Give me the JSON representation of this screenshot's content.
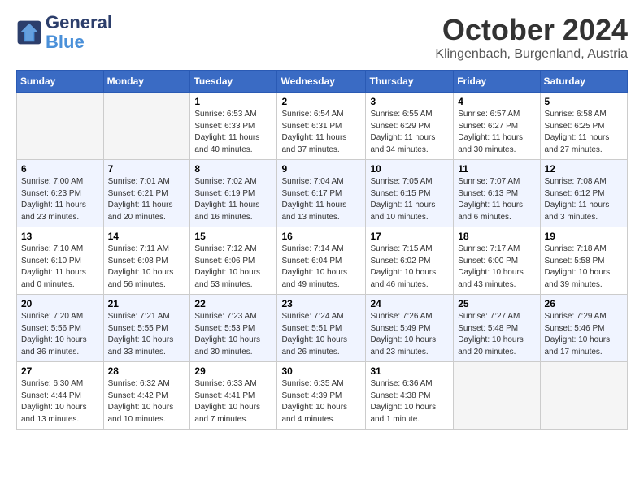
{
  "header": {
    "logo_line1": "General",
    "logo_line2": "Blue",
    "month": "October 2024",
    "location": "Klingenbach, Burgenland, Austria"
  },
  "weekdays": [
    "Sunday",
    "Monday",
    "Tuesday",
    "Wednesday",
    "Thursday",
    "Friday",
    "Saturday"
  ],
  "weeks": [
    [
      {
        "num": "",
        "info": ""
      },
      {
        "num": "",
        "info": ""
      },
      {
        "num": "1",
        "info": "Sunrise: 6:53 AM\nSunset: 6:33 PM\nDaylight: 11 hours and 40 minutes."
      },
      {
        "num": "2",
        "info": "Sunrise: 6:54 AM\nSunset: 6:31 PM\nDaylight: 11 hours and 37 minutes."
      },
      {
        "num": "3",
        "info": "Sunrise: 6:55 AM\nSunset: 6:29 PM\nDaylight: 11 hours and 34 minutes."
      },
      {
        "num": "4",
        "info": "Sunrise: 6:57 AM\nSunset: 6:27 PM\nDaylight: 11 hours and 30 minutes."
      },
      {
        "num": "5",
        "info": "Sunrise: 6:58 AM\nSunset: 6:25 PM\nDaylight: 11 hours and 27 minutes."
      }
    ],
    [
      {
        "num": "6",
        "info": "Sunrise: 7:00 AM\nSunset: 6:23 PM\nDaylight: 11 hours and 23 minutes."
      },
      {
        "num": "7",
        "info": "Sunrise: 7:01 AM\nSunset: 6:21 PM\nDaylight: 11 hours and 20 minutes."
      },
      {
        "num": "8",
        "info": "Sunrise: 7:02 AM\nSunset: 6:19 PM\nDaylight: 11 hours and 16 minutes."
      },
      {
        "num": "9",
        "info": "Sunrise: 7:04 AM\nSunset: 6:17 PM\nDaylight: 11 hours and 13 minutes."
      },
      {
        "num": "10",
        "info": "Sunrise: 7:05 AM\nSunset: 6:15 PM\nDaylight: 11 hours and 10 minutes."
      },
      {
        "num": "11",
        "info": "Sunrise: 7:07 AM\nSunset: 6:13 PM\nDaylight: 11 hours and 6 minutes."
      },
      {
        "num": "12",
        "info": "Sunrise: 7:08 AM\nSunset: 6:12 PM\nDaylight: 11 hours and 3 minutes."
      }
    ],
    [
      {
        "num": "13",
        "info": "Sunrise: 7:10 AM\nSunset: 6:10 PM\nDaylight: 11 hours and 0 minutes."
      },
      {
        "num": "14",
        "info": "Sunrise: 7:11 AM\nSunset: 6:08 PM\nDaylight: 10 hours and 56 minutes."
      },
      {
        "num": "15",
        "info": "Sunrise: 7:12 AM\nSunset: 6:06 PM\nDaylight: 10 hours and 53 minutes."
      },
      {
        "num": "16",
        "info": "Sunrise: 7:14 AM\nSunset: 6:04 PM\nDaylight: 10 hours and 49 minutes."
      },
      {
        "num": "17",
        "info": "Sunrise: 7:15 AM\nSunset: 6:02 PM\nDaylight: 10 hours and 46 minutes."
      },
      {
        "num": "18",
        "info": "Sunrise: 7:17 AM\nSunset: 6:00 PM\nDaylight: 10 hours and 43 minutes."
      },
      {
        "num": "19",
        "info": "Sunrise: 7:18 AM\nSunset: 5:58 PM\nDaylight: 10 hours and 39 minutes."
      }
    ],
    [
      {
        "num": "20",
        "info": "Sunrise: 7:20 AM\nSunset: 5:56 PM\nDaylight: 10 hours and 36 minutes."
      },
      {
        "num": "21",
        "info": "Sunrise: 7:21 AM\nSunset: 5:55 PM\nDaylight: 10 hours and 33 minutes."
      },
      {
        "num": "22",
        "info": "Sunrise: 7:23 AM\nSunset: 5:53 PM\nDaylight: 10 hours and 30 minutes."
      },
      {
        "num": "23",
        "info": "Sunrise: 7:24 AM\nSunset: 5:51 PM\nDaylight: 10 hours and 26 minutes."
      },
      {
        "num": "24",
        "info": "Sunrise: 7:26 AM\nSunset: 5:49 PM\nDaylight: 10 hours and 23 minutes."
      },
      {
        "num": "25",
        "info": "Sunrise: 7:27 AM\nSunset: 5:48 PM\nDaylight: 10 hours and 20 minutes."
      },
      {
        "num": "26",
        "info": "Sunrise: 7:29 AM\nSunset: 5:46 PM\nDaylight: 10 hours and 17 minutes."
      }
    ],
    [
      {
        "num": "27",
        "info": "Sunrise: 6:30 AM\nSunset: 4:44 PM\nDaylight: 10 hours and 13 minutes."
      },
      {
        "num": "28",
        "info": "Sunrise: 6:32 AM\nSunset: 4:42 PM\nDaylight: 10 hours and 10 minutes."
      },
      {
        "num": "29",
        "info": "Sunrise: 6:33 AM\nSunset: 4:41 PM\nDaylight: 10 hours and 7 minutes."
      },
      {
        "num": "30",
        "info": "Sunrise: 6:35 AM\nSunset: 4:39 PM\nDaylight: 10 hours and 4 minutes."
      },
      {
        "num": "31",
        "info": "Sunrise: 6:36 AM\nSunset: 4:38 PM\nDaylight: 10 hours and 1 minute."
      },
      {
        "num": "",
        "info": ""
      },
      {
        "num": "",
        "info": ""
      }
    ]
  ]
}
